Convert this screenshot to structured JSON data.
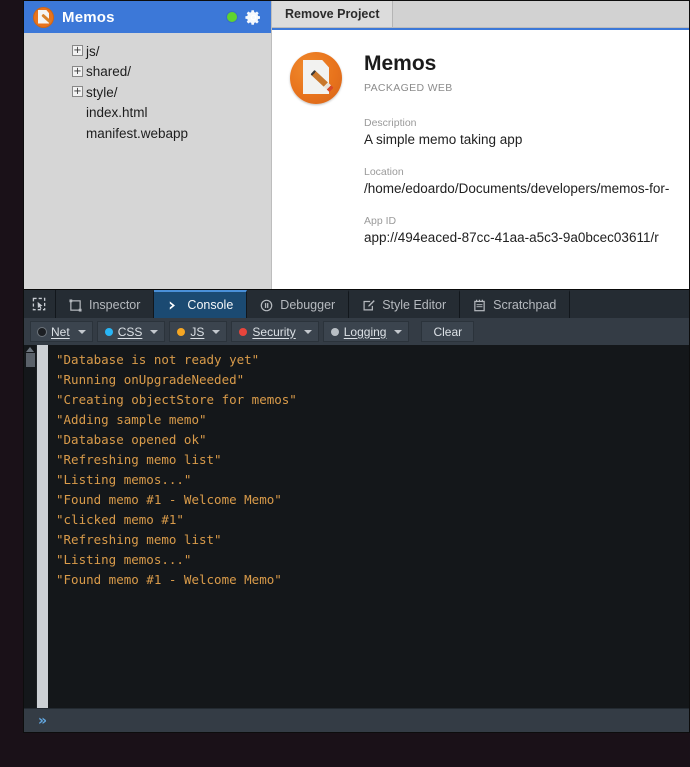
{
  "project_panel": {
    "title": "Memos",
    "status_icon": "green-status-dot",
    "settings_icon": "gear-icon",
    "tree": [
      {
        "label": "js/",
        "type": "folder",
        "expander": "+"
      },
      {
        "label": "shared/",
        "type": "folder",
        "expander": "+"
      },
      {
        "label": "style/",
        "type": "folder",
        "expander": "+"
      },
      {
        "label": "index.html",
        "type": "file",
        "expander": ""
      },
      {
        "label": "manifest.webapp",
        "type": "file",
        "expander": ""
      }
    ]
  },
  "detail_panel": {
    "tab_label": "Remove Project",
    "app_name": "Memos",
    "app_type": "PACKAGED WEB",
    "fields": [
      {
        "label": "Description",
        "value": "A simple memo taking app"
      },
      {
        "label": "Location",
        "value": "/home/edoardo/Documents/developers/memos-for-"
      },
      {
        "label": "App ID",
        "value": "app://494eaced-87cc-41aa-a5c3-9a0bcec03611/r"
      }
    ]
  },
  "devtools": {
    "picker_icon": "element-picker-icon",
    "tabs": [
      {
        "label": "Inspector",
        "icon": "inspector-icon",
        "active": false
      },
      {
        "label": "Console",
        "icon": "console-icon",
        "active": true
      },
      {
        "label": "Debugger",
        "icon": "debugger-icon",
        "active": false
      },
      {
        "label": "Style Editor",
        "icon": "style-editor-icon",
        "active": false
      },
      {
        "label": "Scratchpad",
        "icon": "scratchpad-icon",
        "active": false
      }
    ],
    "filters": [
      {
        "label": "Net",
        "color": "#1c1f23"
      },
      {
        "label": "CSS",
        "color": "#29b6f6"
      },
      {
        "label": "JS",
        "color": "#f5a623"
      },
      {
        "label": "Security",
        "color": "#e8453c"
      },
      {
        "label": "Logging",
        "color": "#b9bfc5"
      }
    ],
    "clear_label": "Clear",
    "console_messages": [
      "\"Database is not ready yet\"",
      "\"Running onUpgradeNeeded\"",
      "\"Creating objectStore for memos\"",
      "\"Adding sample memo\"",
      "\"Database opened ok\"",
      "\"Refreshing memo list\"",
      "\"Listing memos...\"",
      "\"Found memo #1 - Welcome Memo\"",
      "\"clicked memo #1\"",
      "\"Refreshing memo list\"",
      "\"Listing memos...\"",
      "\"Found memo #1 - Welcome Memo\""
    ],
    "prompt_symbol": "»"
  }
}
